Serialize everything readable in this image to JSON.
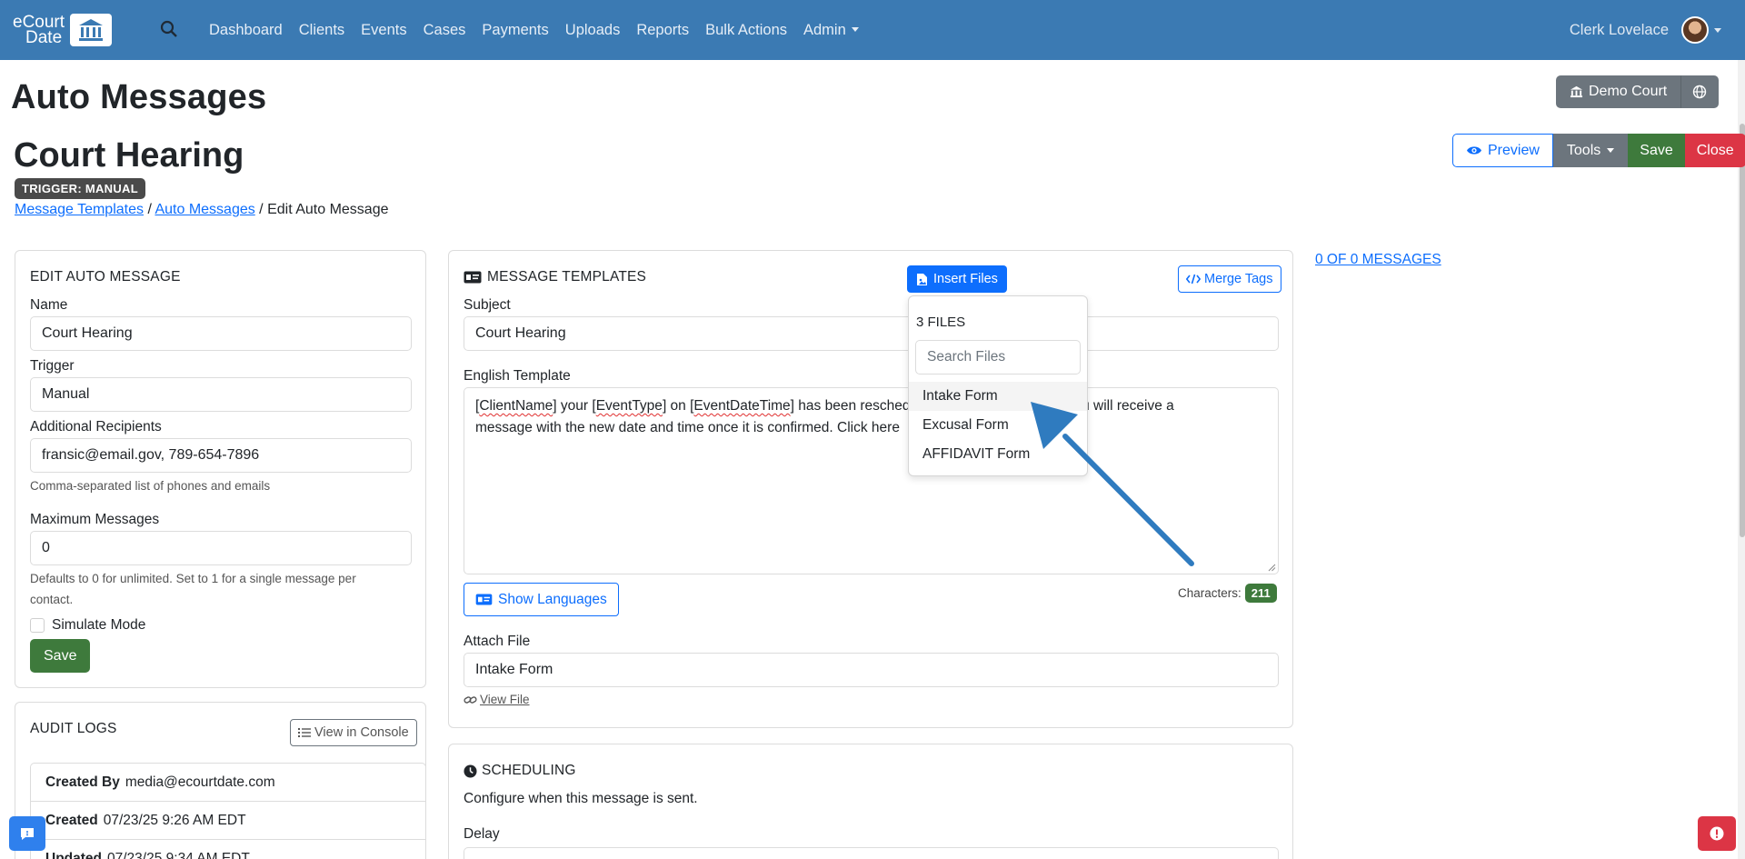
{
  "nav": {
    "logo_line1": "eCourt",
    "logo_line2": "Date",
    "links": [
      "Dashboard",
      "Clients",
      "Events",
      "Cases",
      "Payments",
      "Uploads",
      "Reports",
      "Bulk Actions",
      "Admin"
    ],
    "user_name": "Clerk Lovelace"
  },
  "page": {
    "title": "Auto Messages",
    "message_title": "Court Hearing",
    "trigger_badge": "TRIGGER: MANUAL",
    "breadcrumb": {
      "crumb1": "Message Templates",
      "sep": " / ",
      "crumb2": "Auto Messages",
      "current": "Edit Auto Message"
    }
  },
  "header_buttons": {
    "court": "Demo Court",
    "preview": "Preview",
    "tools": "Tools",
    "save": "Save",
    "close": "Close"
  },
  "edit_card": {
    "title": "EDIT AUTO MESSAGE",
    "name_label": "Name",
    "name_value": "Court Hearing",
    "trigger_label": "Trigger",
    "trigger_value": "Manual",
    "recipients_label": "Additional Recipients",
    "recipients_value": "fransic@email.gov, 789-654-7896",
    "recipients_help": "Comma-separated list of phones and emails",
    "max_label": "Maximum Messages",
    "max_value": "0",
    "max_help_line1": "Defaults to 0 for unlimited. Set to 1 for a single message per",
    "max_help_line2": "contact.",
    "simulate_label": "Simulate Mode",
    "save_label": "Save"
  },
  "audit_card": {
    "title": "AUDIT LOGS",
    "view_console": "View in Console",
    "rows": [
      {
        "label": "Created By",
        "value": "media@ecourtdate.com"
      },
      {
        "label": "Created",
        "value": "07/23/25 9:26 AM EDT"
      },
      {
        "label": "Updated",
        "value": "07/23/25 9:34 AM EDT"
      }
    ]
  },
  "templates_card": {
    "title": "MESSAGE TEMPLATES",
    "insert_files": "Insert Files",
    "merge_tags": "Merge Tags",
    "subject_label": "Subject",
    "subject_value": "Court Hearing",
    "english_label": "English Template",
    "template": {
      "t1": "ClientName",
      "t2": " your ",
      "t3": "EventType",
      "t4": " on ",
      "t5": "EventDateTime",
      "t6": " has been resched",
      "t7": "ourt. You will receive a",
      "line2a": "message with the new date and time once it is confirmed. Click here"
    },
    "show_languages": "Show Languages",
    "characters_label": "Characters:",
    "characters_count": "211",
    "attach_label": "Attach File",
    "attach_value": "Intake Form",
    "view_file": "View File"
  },
  "files_dropdown": {
    "count_label": "3 FILES",
    "search_placeholder": "Search Files",
    "items": [
      "Intake Form",
      "Excusal Form",
      "AFFIDAVIT Form"
    ]
  },
  "scheduling_card": {
    "title": "SCHEDULING",
    "description": "Configure when this message is sent.",
    "delay_label": "Delay"
  },
  "messages_link": "0 OF 0 MESSAGES",
  "colors": {
    "navbar": "#3b7ab3",
    "primary": "#0d6efd",
    "success": "#3e7a3c",
    "danger": "#dc3545",
    "secondary": "#6c757d",
    "arrow": "#2f7bbf"
  },
  "icons": [
    "search-icon",
    "courthouse-icon",
    "bank-icon",
    "globe-icon",
    "eye-icon",
    "id-card-icon",
    "file-image-icon",
    "code-icon",
    "link-icon",
    "list-icon",
    "clock-icon",
    "chat-icon",
    "alert-icon"
  ]
}
